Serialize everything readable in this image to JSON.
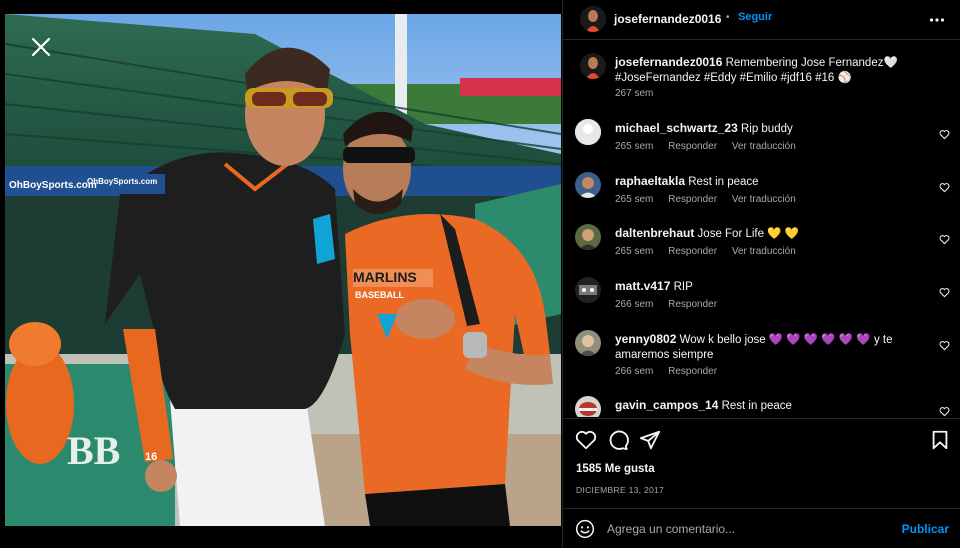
{
  "post": {
    "username": "josefernandez0016",
    "separator": "•",
    "follow_label": "Seguir",
    "more_icon": "more-horizontal-icon"
  },
  "photo": {
    "banner_text": "OhBoySports.com",
    "banner_text_2": "OhBoySports.com",
    "jersey_text": "MARLINS",
    "jersey_text_2": "BASEBALL",
    "wall_text": "BB",
    "arm_number": "16",
    "close_icon": "close-icon"
  },
  "caption": {
    "username": "josefernandez0016",
    "text": "Remembering Jose Fernandez🤍 #JoseFernandez #Eddy #Emilio #jdf16 #16 ⚾",
    "time": "267 sem"
  },
  "comments": [
    {
      "username": "michael_schwartz_23",
      "text": "Rip buddy",
      "time": "265 sem",
      "reply": "Responder",
      "translate": "Ver traducción"
    },
    {
      "username": "raphaeltakla",
      "text": "Rest in peace",
      "time": "265 sem",
      "reply": "Responder",
      "translate": "Ver traducción"
    },
    {
      "username": "daltenbrehaut",
      "text": "Jose For Life 💛 💛",
      "time": "265 sem",
      "reply": "Responder",
      "translate": "Ver traducción"
    },
    {
      "username": "matt.v417",
      "text": "RIP",
      "time": "266 sem",
      "reply": "Responder",
      "translate": ""
    },
    {
      "username": "yenny0802",
      "text": "Wow k bello jose 💜 💜 💜 💜 💜 💜 y te amaremos siempre",
      "time": "266 sem",
      "reply": "Responder",
      "translate": ""
    },
    {
      "username": "gavin_campos_14",
      "text": "Rest in peace",
      "time": "",
      "reply": "",
      "translate": ""
    }
  ],
  "actions": {
    "like_icon": "heart-icon",
    "comment_icon": "comment-icon",
    "share_icon": "send-icon",
    "save_icon": "bookmark-icon",
    "likes": "1585 Me gusta",
    "date": "DICIEMBRE 13, 2017"
  },
  "add_comment": {
    "emoji_icon": "emoji-icon",
    "placeholder": "Agrega un comentario...",
    "publish_label": "Publicar"
  },
  "colors": {
    "accent": "#0095f6",
    "background": "#000000",
    "divider": "#262626",
    "muted_text": "#a8a8a8"
  }
}
